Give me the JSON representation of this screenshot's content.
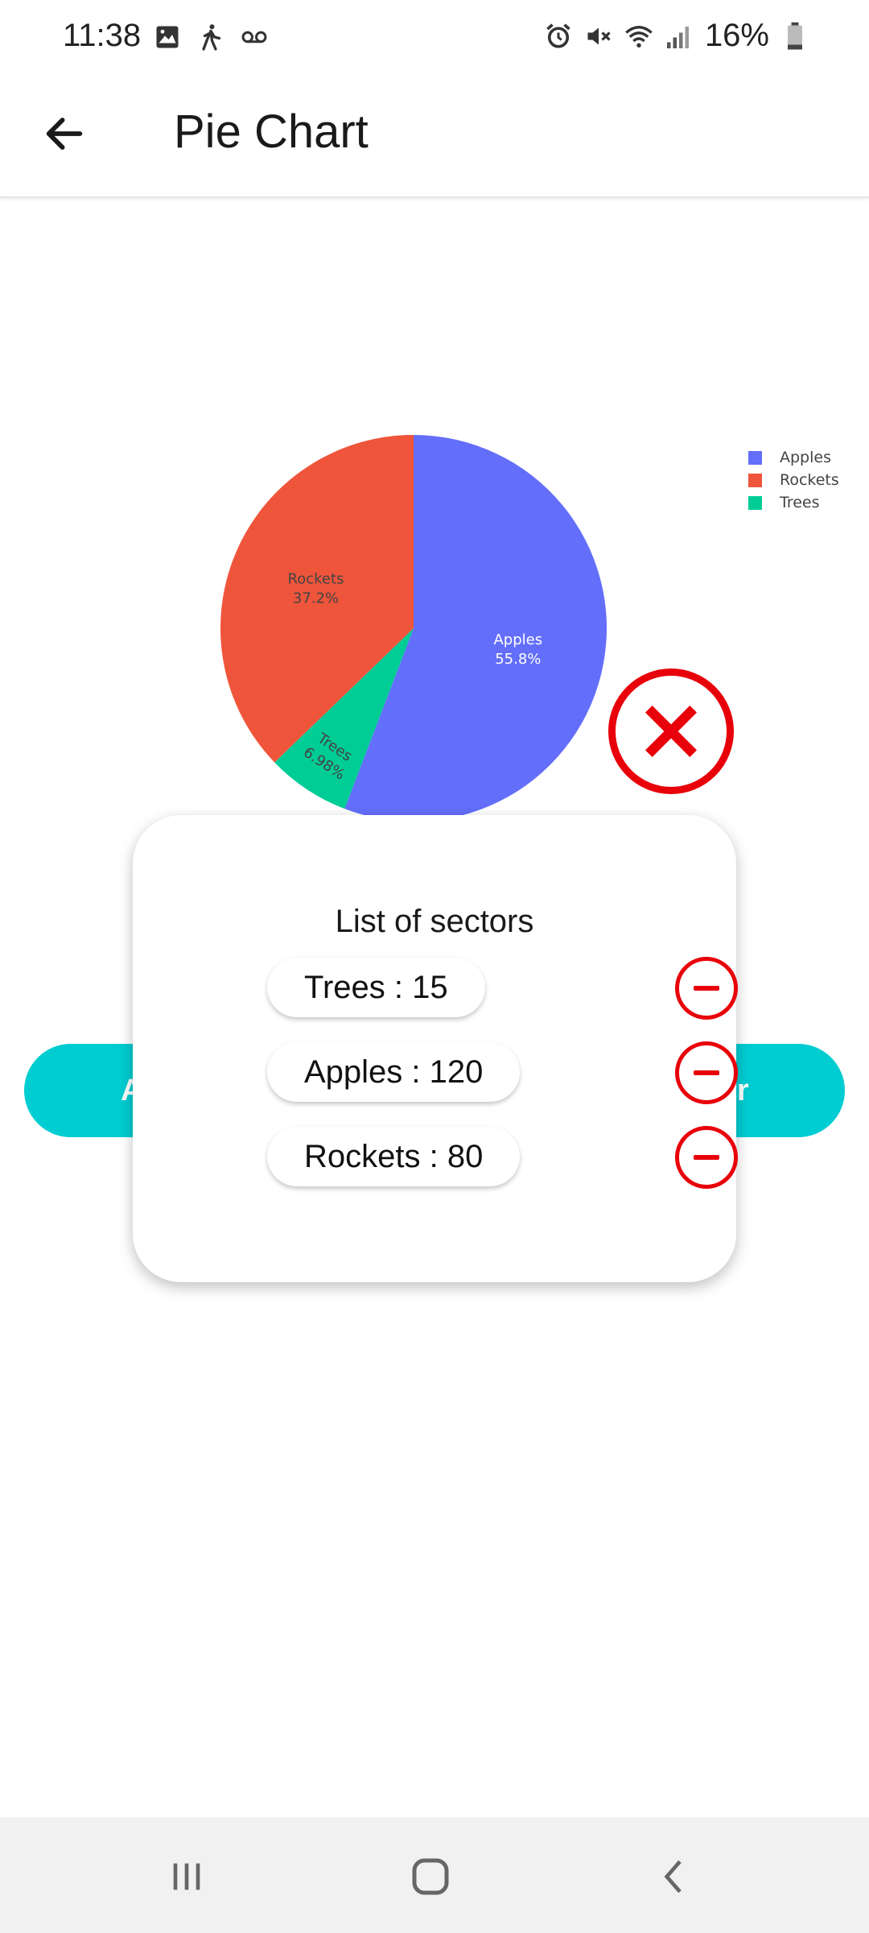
{
  "status_bar": {
    "time": "11:38",
    "battery": "16%",
    "left_icons": [
      "image-icon",
      "walking-icon",
      "voicemail-icon"
    ],
    "right_icons": [
      "alarm-icon",
      "mute-icon",
      "wifi-icon",
      "signal-icon",
      "battery-icon"
    ]
  },
  "app_bar": {
    "title": "Pie Chart",
    "back_icon": "arrow-left-icon"
  },
  "chart_data": {
    "type": "pie",
    "categories": [
      "Apples",
      "Rockets",
      "Trees"
    ],
    "values": [
      120,
      80,
      15
    ],
    "percent_labels": [
      "55.8%",
      "37.2%",
      "6.98%"
    ],
    "colors": [
      "#636efa",
      "#ef553b",
      "#00cc96"
    ],
    "legend_position": "top-right"
  },
  "background_buttons": {
    "left_label": "A",
    "right_label": "tor"
  },
  "dialog": {
    "title": "List of sectors",
    "sectors": [
      {
        "label": "Trees : 15"
      },
      {
        "label": "Apples : 120"
      },
      {
        "label": "Rockets : 80"
      }
    ],
    "close_icon": "close-icon",
    "remove_icon": "minus-circle-icon"
  },
  "nav_bar": {
    "icons": [
      "recent-apps-icon",
      "home-icon",
      "back-icon"
    ]
  },
  "colors": {
    "accent": "#00cdd1",
    "danger": "#e8000a"
  }
}
